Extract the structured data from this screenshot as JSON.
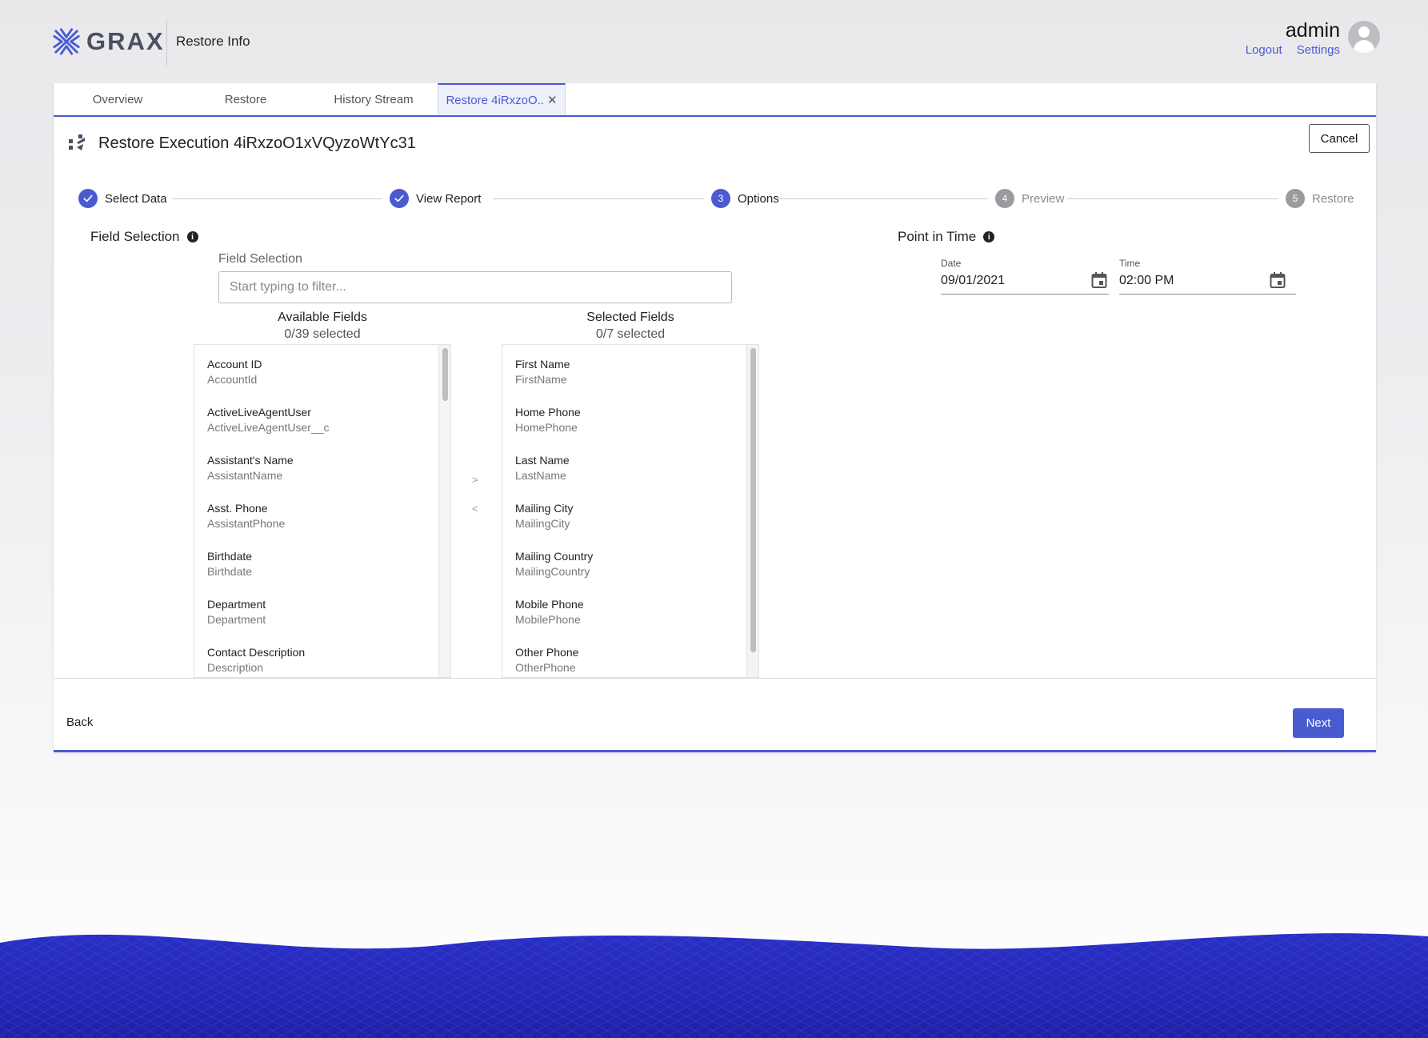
{
  "header": {
    "logo_text": "GRAX",
    "app_title": "Restore Info",
    "user_name": "admin",
    "logout_label": "Logout",
    "settings_label": "Settings"
  },
  "tabs": [
    {
      "label": "Overview"
    },
    {
      "label": "Restore"
    },
    {
      "label": "History Stream"
    },
    {
      "label": "Restore 4iRxzoO.."
    }
  ],
  "execution": {
    "title": "Restore Execution 4iRxzoO1xVQyzoWtYc31",
    "cancel_label": "Cancel"
  },
  "stepper": [
    {
      "number": "1",
      "label": "Select Data",
      "status": "done"
    },
    {
      "number": "2",
      "label": "View Report",
      "status": "done"
    },
    {
      "number": "3",
      "label": "Options",
      "status": "current"
    },
    {
      "number": "4",
      "label": "Preview",
      "status": "todo"
    },
    {
      "number": "5",
      "label": "Restore",
      "status": "todo"
    }
  ],
  "field_selection": {
    "section_label": "Field Selection",
    "caption": "Field Selection",
    "filter_placeholder": "Start typing to filter...",
    "available": {
      "title": "Available Fields",
      "count": "0/39 selected",
      "items": [
        {
          "label": "Account ID",
          "api": "AccountId"
        },
        {
          "label": "ActiveLiveAgentUser",
          "api": "ActiveLiveAgentUser__c"
        },
        {
          "label": "Assistant's Name",
          "api": "AssistantName"
        },
        {
          "label": "Asst. Phone",
          "api": "AssistantPhone"
        },
        {
          "label": "Birthdate",
          "api": "Birthdate"
        },
        {
          "label": "Department",
          "api": "Department"
        },
        {
          "label": "Contact Description",
          "api": "Description"
        }
      ]
    },
    "selected": {
      "title": "Selected Fields",
      "count": "0/7 selected",
      "items": [
        {
          "label": "First Name",
          "api": "FirstName"
        },
        {
          "label": "Home Phone",
          "api": "HomePhone"
        },
        {
          "label": "Last Name",
          "api": "LastName"
        },
        {
          "label": "Mailing City",
          "api": "MailingCity"
        },
        {
          "label": "Mailing Country",
          "api": "MailingCountry"
        },
        {
          "label": "Mobile Phone",
          "api": "MobilePhone"
        },
        {
          "label": "Other Phone",
          "api": "OtherPhone"
        }
      ]
    },
    "move_right": ">",
    "move_left": "<"
  },
  "point_in_time": {
    "section_label": "Point in Time",
    "date_caption": "Date",
    "date_value": "09/01/2021",
    "time_caption": "Time",
    "time_value": "02:00 PM"
  },
  "footer": {
    "back_label": "Back",
    "next_label": "Next"
  },
  "colors": {
    "accent": "#4a5bd0",
    "inactive_step": "#9a9a9f"
  }
}
